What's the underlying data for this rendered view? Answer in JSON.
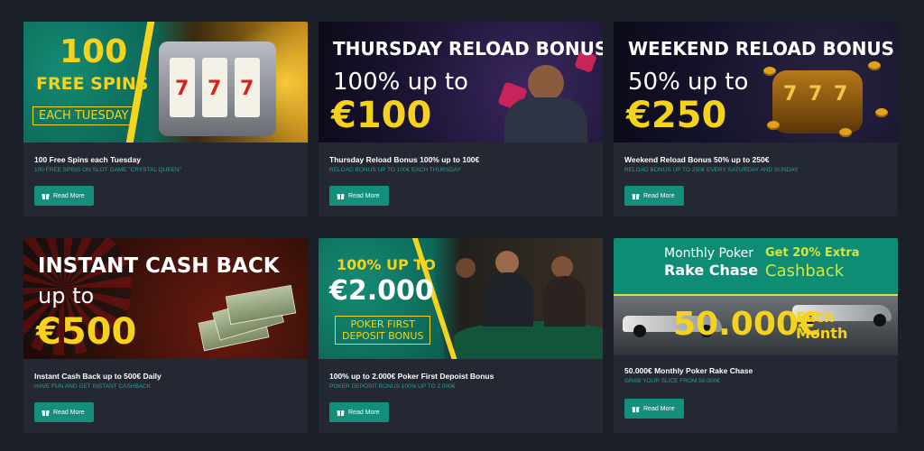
{
  "cards": [
    {
      "title": "100 Free Spins each Tuesday",
      "subtitle": "100 FREE SPINS ON SLOT GAME \"Crystal Queen\"",
      "button": "Read More",
      "banner": {
        "line1": "100",
        "line2": "FREE SPINS",
        "line3": "EACH TUESDAY",
        "reel_symbol": "7"
      }
    },
    {
      "title": "Thursday Reload Bonus 100% up to 100€",
      "subtitle": "RELOAD BONUS UP TO 100€ EACH THURSDAY",
      "button": "Read More",
      "banner": {
        "headline": "THURSDAY RELOAD BONUS",
        "line2": "100% up to",
        "amount": "€100"
      }
    },
    {
      "title": "Weekend Reload Bonus 50% up to 250€",
      "subtitle": "RELOAD BONUS UP TO 250€ EVERY SATURDAY AND SUNDAY",
      "button": "Read More",
      "banner": {
        "headline": "WEEKEND RELOAD BONUS",
        "line2": "50% up to",
        "amount": "€250",
        "reel_symbol": "7"
      }
    },
    {
      "title": "Instant Cash Back up to 500€ Daily",
      "subtitle": "HAVE FUN AND GET INSTANT CASHBACK",
      "button": "Read More",
      "banner": {
        "headline": "INSTANT CASH BACK",
        "line2": "up to",
        "amount": "€500"
      }
    },
    {
      "title": "100% up to 2.000€ Poker First Depoist Bonus",
      "subtitle": "POKER DEPOSIT BONUS 100% up to 2.000€",
      "button": "Read More",
      "banner": {
        "line1": "100% UP TO",
        "amount": "€2.000",
        "box1": "POKER FIRST",
        "box2": "DEPOSIT BONUS"
      }
    },
    {
      "title": "50.000€ Monthly Poker Rake Chase",
      "subtitle": "GRAB YOUR SLICE FROM 50.000€",
      "button": "Read More",
      "banner": {
        "l1": "Monthly Poker",
        "l2": "Rake Chase",
        "r1": "Get 20% Extra",
        "r2": "Cashback",
        "amount": "50.000€",
        "each": "Each",
        "month": "Month"
      }
    }
  ],
  "colors": {
    "page_bg": "#1b1f28",
    "card_bg": "#232833",
    "accent_teal": "#1aa893",
    "button_bg": "#138f7c",
    "banner_yellow": "#f5d21c"
  },
  "icons": {
    "button_icon": "gift-icon"
  }
}
